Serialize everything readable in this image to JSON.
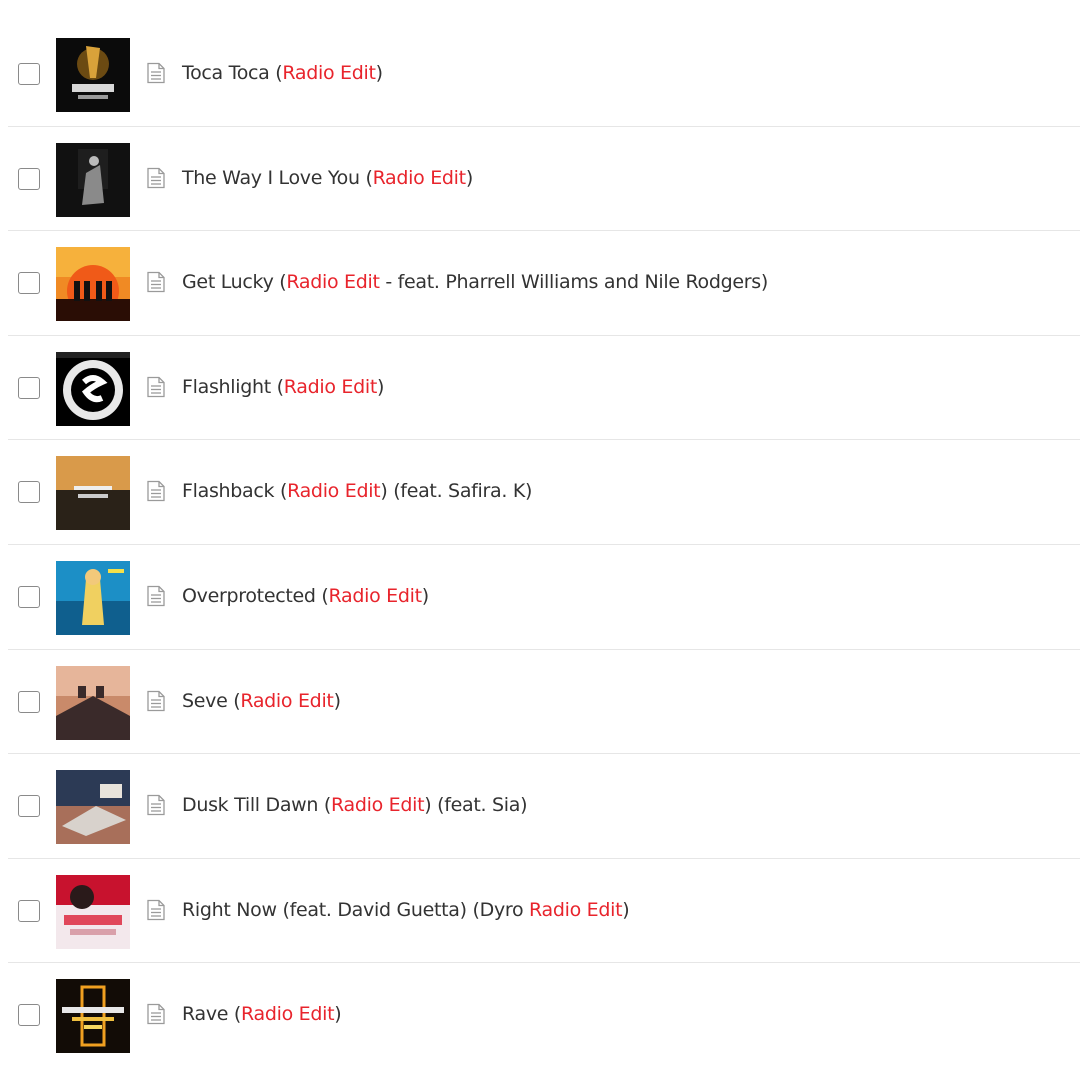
{
  "highlight_color": "#e8242c",
  "row_icon": "lyrics-document-icon",
  "tracks": [
    {
      "cover": "fly-project-toca-toca-cover",
      "title": [
        {
          "t": "Toca Toca ("
        },
        {
          "t": "Radio Edit",
          "hl": true
        },
        {
          "t": ")"
        }
      ]
    },
    {
      "cover": "the-way-i-love-you-cover",
      "title": [
        {
          "t": "The Way I Love You ("
        },
        {
          "t": "Radio Edit",
          "hl": true
        },
        {
          "t": ")"
        }
      ]
    },
    {
      "cover": "get-lucky-cover",
      "title": [
        {
          "t": "Get Lucky ("
        },
        {
          "t": "Radio Edit",
          "hl": true
        },
        {
          "t": " - feat. Pharrell Williams and Nile Rodgers)"
        }
      ]
    },
    {
      "cover": "flashlight-spinnin-cover",
      "title": [
        {
          "t": "Flashlight ("
        },
        {
          "t": "Radio Edit",
          "hl": true
        },
        {
          "t": ")"
        }
      ]
    },
    {
      "cover": "flashback-cover",
      "title": [
        {
          "t": "Flashback ("
        },
        {
          "t": "Radio Edit",
          "hl": true
        },
        {
          "t": ") (feat. Safira. K)"
        }
      ]
    },
    {
      "cover": "overprotected-cover",
      "title": [
        {
          "t": "Overprotected ("
        },
        {
          "t": "Radio Edit",
          "hl": true
        },
        {
          "t": ")"
        }
      ]
    },
    {
      "cover": "seve-cover",
      "title": [
        {
          "t": "Seve ("
        },
        {
          "t": "Radio Edit",
          "hl": true
        },
        {
          "t": ")"
        }
      ]
    },
    {
      "cover": "dusk-till-dawn-cover",
      "title": [
        {
          "t": "Dusk Till Dawn ("
        },
        {
          "t": "Radio Edit",
          "hl": true
        },
        {
          "t": ") (feat. Sia)"
        }
      ]
    },
    {
      "cover": "right-now-cover",
      "title": [
        {
          "t": "Right Now (feat. David Guetta) (Dyro "
        },
        {
          "t": "Radio Edit",
          "hl": true
        },
        {
          "t": ")"
        }
      ]
    },
    {
      "cover": "rave-cover",
      "title": [
        {
          "t": "Rave ("
        },
        {
          "t": "Radio Edit",
          "hl": true
        },
        {
          "t": ")"
        }
      ]
    }
  ]
}
